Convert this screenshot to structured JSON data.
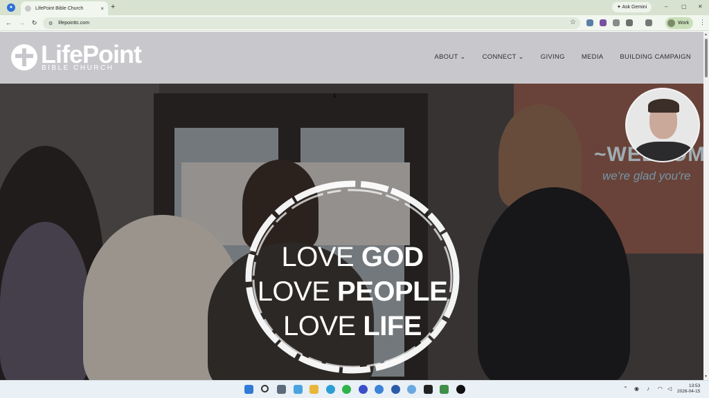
{
  "browser": {
    "tab_title": "LifePoint Bible Church",
    "tab_close": "×",
    "new_tab": "+",
    "ask_gemini": "Ask Gemini",
    "url": "lifepointtc.com",
    "profile_label": "Work",
    "window_controls": [
      "–",
      "▢",
      "✕"
    ]
  },
  "site": {
    "logo_title": "LifePoint",
    "logo_subtitle": "BIBLE CHURCH",
    "nav": [
      {
        "label": "ABOUT",
        "has_dropdown": true
      },
      {
        "label": "CONNECT",
        "has_dropdown": true
      },
      {
        "label": "GIVING",
        "has_dropdown": false
      },
      {
        "label": "MEDIA",
        "has_dropdown": false
      },
      {
        "label": "BUILDING CAMPAIGN",
        "has_dropdown": false
      }
    ],
    "dropdown_glyph": "⌄",
    "hero": {
      "lines": [
        {
          "light": "LOVE ",
          "bold": "GOD"
        },
        {
          "light": "LOVE ",
          "bold": "PEOPLE"
        },
        {
          "light": "LOVE ",
          "bold": "LIFE"
        }
      ],
      "screen_text": "~WELCOM",
      "screen_subtext": "we're glad you're"
    }
  },
  "taskbar": {
    "clock_time": "13:53",
    "clock_date": "2026-04-15"
  }
}
